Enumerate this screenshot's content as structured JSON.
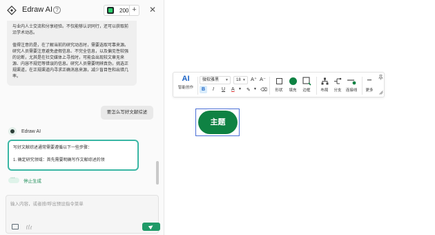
{
  "panel": {
    "app_title": "Edraw AI",
    "help_glyph": "?",
    "credits": "200",
    "credits_plus": "+",
    "close_glyph": "✕",
    "previous_paragraph_1": "与业内人士交流和分享经验。不仅能够认识同行，还可以获取前沿学术动态。",
    "previous_paragraph_2": "值得注意的是，在了解当前的研究动态时，需要选取可靠来源。研究人员需要注意避免虚假信息、不完全信息，以及偏见性较强的论断，尤其是在社交媒体上寻找时，可能会出现较文章无来源、内容不规范等错误的信息。研究人员需要明辨真伪，挑选正规渠道，在正规渠道内寻求正确消息来源，减少盲目性和出错几率。",
    "user_question": "要怎么写好文献综述",
    "ai_name": "Edraw AI",
    "ai_line_1": "写好文献综述通常需要遵循以下一些步骤：",
    "ai_line_2": "1. 确定研究领域：首先需要明确写作文献综述的领",
    "stop_label": "停止生成",
    "input_placeholder": "输入内容，或者按/呼出预设指令菜单",
    "icons": [
      "diamond-logo-icon",
      "help-icon",
      "gem-icon",
      "close-icon",
      "ai-avatar-icon",
      "stop-icon",
      "image-icon",
      "voice-icon",
      "send-icon"
    ]
  },
  "toolbar": {
    "ai_label": "AI",
    "ai_caption": "智能创作",
    "font_family": "微软雅黑",
    "font_size": "18",
    "increase_glyph": "A⁺",
    "decrease_glyph": "A⁻",
    "bold": "B",
    "italic": "I",
    "underline": "U",
    "font_color": "A",
    "highlight": "✎",
    "clear_format": "⌫",
    "tools": {
      "shape": "形状",
      "fill": "填充",
      "border": "边框",
      "layout": "布局",
      "branch": "分支",
      "connector": "连接线",
      "more": "更多"
    },
    "more_glyph": "•••",
    "colors": {
      "accent": "#1a62c5",
      "fill": "#0f8243",
      "bold_bg": "#d9ecfb"
    }
  },
  "canvas": {
    "topic_text": "主题",
    "topic_color": "#0f8243",
    "selection_color": "#4a6fd6"
  }
}
